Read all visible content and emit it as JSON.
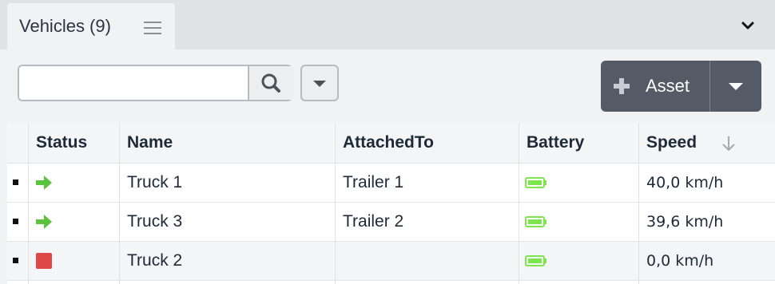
{
  "tab": {
    "title": "Vehicles (9)",
    "menu_icon": "hamburger-icon"
  },
  "header": {
    "collapse_icon": "chevron-down-icon"
  },
  "toolbar": {
    "search_placeholder": "",
    "search_value": "",
    "search_icon": "search-icon",
    "filter_icon": "caret-down-icon",
    "asset_label": "Asset",
    "asset_icon": "plus-icon",
    "asset_dropdown_icon": "caret-down-icon"
  },
  "colors": {
    "accent_button": "#545b66",
    "moving": "#5cc33f",
    "stopped": "#e04848",
    "battery": "#7ce64c"
  },
  "table": {
    "columns": [
      "Status",
      "Name",
      "AttachedTo",
      "Battery",
      "Speed"
    ],
    "sort": {
      "column": "Speed",
      "direction": "descending",
      "icon": "arrow-down-icon"
    },
    "rows": [
      {
        "status": "moving",
        "status_icon": "arrow-right-icon",
        "name": "Truck 1",
        "attached_to": "Trailer 1",
        "battery_icon": "battery-full-icon",
        "speed": "40,0 km/h"
      },
      {
        "status": "moving",
        "status_icon": "arrow-right-icon",
        "name": "Truck 3",
        "attached_to": "Trailer 2",
        "battery_icon": "battery-full-icon",
        "speed": "39,6 km/h"
      },
      {
        "status": "stopped",
        "status_icon": "stop-square-icon",
        "name": "Truck 2",
        "attached_to": "",
        "battery_icon": "battery-full-icon",
        "speed": "0,0 km/h"
      }
    ]
  }
}
